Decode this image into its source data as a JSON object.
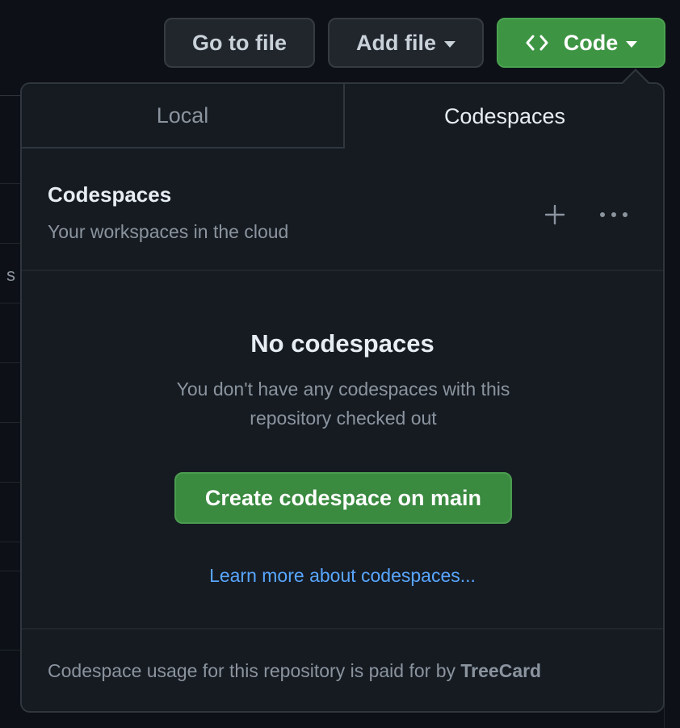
{
  "toolbar": {
    "go_to_file_label": "Go to file",
    "add_file_label": "Add file",
    "code_label": "Code"
  },
  "background": {
    "peek_text": "s"
  },
  "tabs": [
    {
      "label": "Local",
      "selected": false
    },
    {
      "label": "Codespaces",
      "selected": true
    }
  ],
  "codespaces": {
    "title": "Codespaces",
    "subtitle": "Your workspaces in the cloud",
    "empty_title": "No codespaces",
    "empty_description": "You don't have any codespaces with this repository checked out",
    "create_button_label": "Create codespace on main",
    "learn_more_link": "Learn more about codespaces...",
    "footer_prefix": "Codespace usage for this repository is paid for by",
    "footer_owner": "TreeCard"
  },
  "icons": {
    "code": "code-icon",
    "add": "plus-icon",
    "more": "kebab-horizontal-icon",
    "caret": "triangle-down-icon"
  },
  "colors": {
    "background": "#0d1117",
    "panel": "#161b22",
    "border": "#30363d",
    "primary_green": "#3d9443",
    "link_blue": "#58a6ff",
    "text_primary": "#e6edf3",
    "text_muted": "#8b949e"
  }
}
